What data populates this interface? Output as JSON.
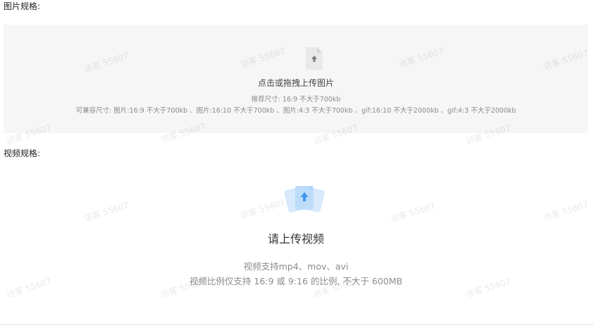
{
  "image_section": {
    "label": "图片规格:",
    "title": "点击或拖拽上传图片",
    "recommend": "推荐尺寸: 16:9 不大于700kb",
    "compat": "可兼容尺寸: 图片:16:9 不大于700kb 、图片:16:10 不大于700kb 、图片:4:3 不大于700kb 、gif:16:10 不大于2000kb 、gif:4:3 不大于2000kb",
    "icon": "upload-file-icon"
  },
  "video_section": {
    "label": "视频规格:",
    "title": "请上传视频",
    "formats": "视频支持mp4、mov、avi",
    "ratio": "视频比例仅支持 16:9 或 9:16 的比例, 不大于 600MB",
    "icon": "upload-video-icon"
  },
  "watermark": {
    "text": "访客 55607"
  },
  "colors": {
    "accent": "#4a9ff5",
    "upload_area_bg": "#f6f6f6",
    "muted_text": "#8a8a8a"
  }
}
